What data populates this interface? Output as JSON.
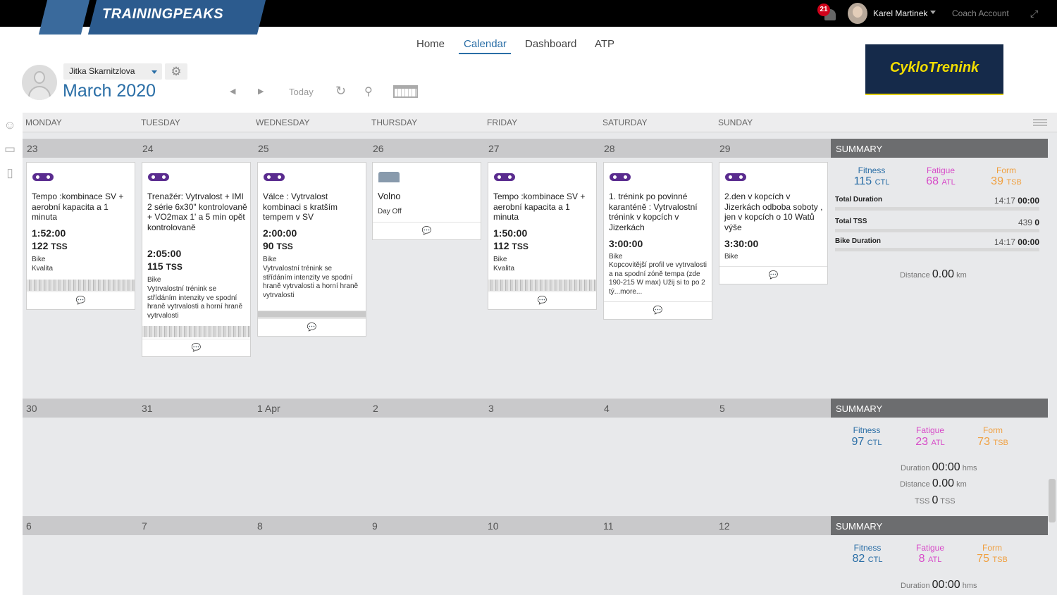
{
  "app": {
    "logo": "TRAININGPEAKS",
    "notifications": "21",
    "user": "Karel Martinek",
    "coach_account": "Coach Account"
  },
  "nav": {
    "home": "Home",
    "calendar": "Calendar",
    "dashboard": "Dashboard",
    "atp": "ATP"
  },
  "sponsor": "CykloTrenink",
  "athlete": {
    "name": "Jitka Skarnitzlova"
  },
  "period": {
    "label": "March 2020"
  },
  "toolbar": {
    "today": "Today"
  },
  "days": [
    "MONDAY",
    "TUESDAY",
    "WEDNESDAY",
    "THURSDAY",
    "FRIDAY",
    "SATURDAY",
    "SUNDAY"
  ],
  "weeks": [
    {
      "dates": [
        "23",
        "24",
        "25",
        "26",
        "27",
        "28",
        "29"
      ],
      "summary_label": "SUMMARY"
    },
    {
      "dates": [
        "30",
        "31",
        "1 Apr",
        "2",
        "3",
        "4",
        "5"
      ],
      "summary_label": "SUMMARY"
    },
    {
      "dates": [
        "6",
        "7",
        "8",
        "9",
        "10",
        "11",
        "12"
      ],
      "summary_label": "SUMMARY"
    }
  ],
  "workouts": [
    {
      "title": "Tempo :kombinace SV + aerobní kapacita a 1 minuta",
      "duration": "1:52:00",
      "tss": "122",
      "type": "Bike",
      "desc": "Kvalita"
    },
    {
      "title": "Trenažér: Vytrvalost + IMI 2 série 6x30\" kontrolovaně + VO2max 1' a 5 min opět kontrolovaně",
      "duration": "2:05:00",
      "tss": "115",
      "type": "Bike",
      "desc": "Vytrvalostní trénink se střídáním intenzity ve spodní hraně vytrvalosti a horní hraně vytrvalosti"
    },
    {
      "title": "Válce : Vytrvalost kombinaci s kratším tempem v SV",
      "duration": "2:00:00",
      "tss": "90",
      "type": "Bike",
      "desc": "Vytrvalostní trénink se střídáním intenzity ve spodní hraně vytrvalosti a horní hraně vytrvalosti"
    },
    {
      "title": "Volno",
      "type": "Day Off"
    },
    {
      "title": "Tempo :kombinace SV + aerobní kapacita a 1 minuta",
      "duration": "1:50:00",
      "tss": "112",
      "type": "Bike",
      "desc": "Kvalita"
    },
    {
      "title": "1. trénink po povinné karanténě : Vytrvalostní trénink v kopcích v Jizerkách",
      "duration": "3:00:00",
      "type": "Bike",
      "desc": "Kopcovitější profil ve vytrvalosti a na spodní zóně tempa (zde 190-215 W max) Užij si to po 2 tý...more..."
    },
    {
      "title": "2.den v kopcích v Jizerkách odboba soboty , jen v kopcích o 10 Watů výše",
      "duration": "3:30:00",
      "type": "Bike"
    }
  ],
  "labels": {
    "tss_unit": "TSS",
    "fitness": "Fitness",
    "fatigue": "Fatigue",
    "form": "Form",
    "ctl": "CTL",
    "atl": "ATL",
    "tsb": "TSB",
    "total_duration": "Total Duration",
    "total_tss": "Total TSS",
    "bike_duration": "Bike Duration",
    "distance": "Distance",
    "duration": "Duration",
    "tss": "TSS",
    "km": "km",
    "hms": "hms"
  },
  "summaries": [
    {
      "fitness": "115",
      "fatigue": "68",
      "form": "39",
      "total_duration_planned": "14:17",
      "total_duration_completed": "00:00",
      "total_tss_planned": "439",
      "total_tss_completed": "0",
      "bike_duration_planned": "14:17",
      "bike_duration_completed": "00:00",
      "distance": "0.00"
    },
    {
      "fitness": "97",
      "fatigue": "23",
      "form": "73",
      "duration": "00:00",
      "distance": "0.00",
      "tss": "0"
    },
    {
      "fitness": "82",
      "fatigue": "8",
      "form": "75",
      "duration": "00:00"
    }
  ],
  "colors": {
    "accent": "#2a6ea6",
    "fatigue": "#d74ac8",
    "form": "#f0a040",
    "workout_icon": "#5a2c8f"
  }
}
